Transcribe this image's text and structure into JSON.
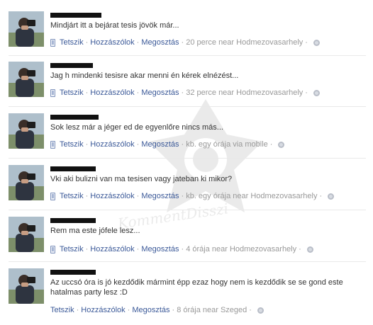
{
  "actions": {
    "like": "Tetszik",
    "comment": "Hozzászólok",
    "share": "Megosztás",
    "separator": "·"
  },
  "icons": {
    "mobile": "mobile-phone-icon",
    "privacy": "globe-icon"
  },
  "colors": {
    "link": "#3b5998",
    "meta": "#999999",
    "text": "#333333"
  },
  "posts": [
    {
      "message": "Mindjárt itt a bejárat tesis jövök már...",
      "meta": "20 perce near Hodmezovasarhely",
      "mobile": true
    },
    {
      "message": "Jag h mindenki tesisre akar menni én kérek elnézést...",
      "meta": "32 perce near Hodmezovasarhely",
      "mobile": true
    },
    {
      "message": "Sok lesz már a jéger ed de egyenlőre nincs más...",
      "meta": "kb. egy órája via mobile",
      "mobile": true
    },
    {
      "message": "Vki aki bulizni van ma tesisen vagy jateban ki mikor?",
      "meta": "kb. egy órája near Hodmezovasarhely",
      "mobile": true
    },
    {
      "message": "Rem ma este jófele lesz...",
      "meta": "4 órája near Hodmezovasarhely",
      "mobile": true
    },
    {
      "message": "Az uccsó óra is jó kezdődik mármint épp ezaz hogy nem is kezdődik se se gond este hatalmas party lesz :D",
      "meta": "8 órája near Szeged",
      "mobile": false
    }
  ],
  "watermark": "KommentDisszi"
}
